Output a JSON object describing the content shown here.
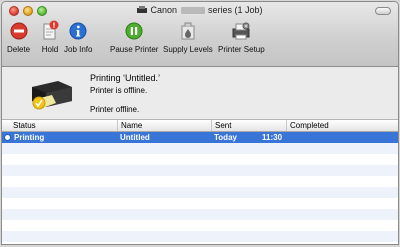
{
  "window": {
    "title_prefix": "Canon",
    "title_suffix": "series (1 Job)"
  },
  "toolbar": {
    "delete_label": "Delete",
    "hold_label": "Hold",
    "jobinfo_label": "Job Info",
    "pause_label": "Pause Printer",
    "supply_label": "Supply Levels",
    "setup_label": "Printer Setup"
  },
  "info": {
    "job_title": "Printing ‘Untitled.’",
    "job_status": "Printer is offline.",
    "printer_status": "Printer offline."
  },
  "table": {
    "headers": {
      "status": "Status",
      "name": "Name",
      "sent": "Sent",
      "completed": "Completed"
    },
    "rows": [
      {
        "status": "Printing",
        "name": "Untitled",
        "sent_day": "Today",
        "sent_time": "11:30",
        "completed": ""
      }
    ]
  },
  "colors": {
    "selection": "#3875d7",
    "accent_delete": "#d83a2e",
    "accent_info": "#2a6fd4",
    "accent_pause": "#4fae2e"
  },
  "icons": {
    "delete": "delete-icon",
    "hold": "hold-icon",
    "job_info": "info-icon",
    "pause": "pause-icon",
    "supply": "supply-levels-icon",
    "setup": "printer-setup-icon"
  }
}
